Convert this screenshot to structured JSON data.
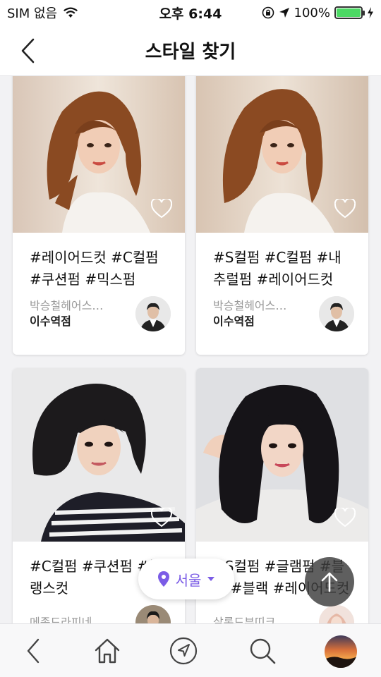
{
  "status_bar": {
    "carrier": "SIM 없음",
    "time": "오후 6:44",
    "battery_percent": "100%",
    "battery_level": 1.0
  },
  "header": {
    "title": "스타일 찾기",
    "back_icon": "chevron-left-icon"
  },
  "cards": [
    {
      "tags": "#레이어드컷 #C컬펌 #쿠션펌 #믹스펌",
      "shop": "박승철헤어스…",
      "branch": "이수역점"
    },
    {
      "tags": "#S컬펌 #C컬펌 #내추럴펌 #레이어드컷",
      "shop": "박승철헤어스…",
      "branch": "이수역점"
    },
    {
      "tags": "#C컬펌 #쿠션펌 #블랭스컷",
      "shop": "메종드라피네",
      "branch": ""
    },
    {
      "tags": "#S컬펌 #글램펌 #블랙 #블랙 #레이어드컷",
      "shop": "살롱드부띠크",
      "branch": ""
    }
  ],
  "location_filter": {
    "label": "서울",
    "icon": "map-pin-icon",
    "accent": "#7b5ce6"
  },
  "scroll_top_icon": "arrow-up-icon",
  "tabbar": {
    "items": [
      "back-icon",
      "home-icon",
      "navigation-icon",
      "search-icon",
      "profile-avatar"
    ]
  }
}
